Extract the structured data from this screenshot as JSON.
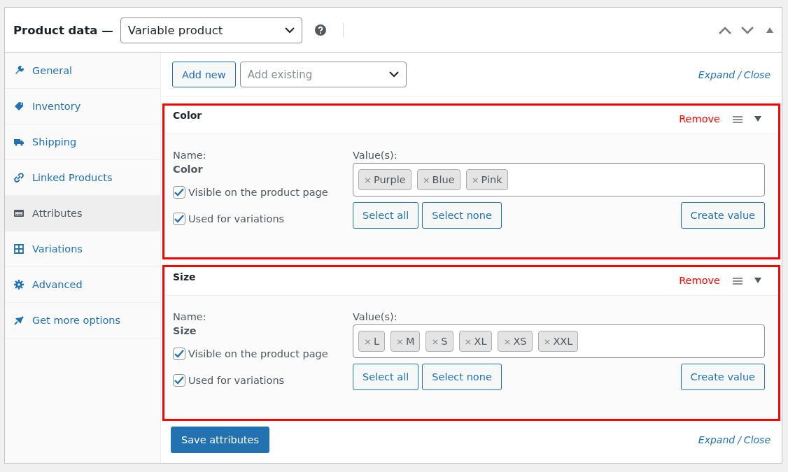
{
  "header": {
    "title": "Product data —",
    "product_type": "Variable product"
  },
  "sidebar": {
    "items": [
      {
        "label": "General",
        "selected": false
      },
      {
        "label": "Inventory",
        "selected": false
      },
      {
        "label": "Shipping",
        "selected": false
      },
      {
        "label": "Linked Products",
        "selected": false
      },
      {
        "label": "Attributes",
        "selected": true
      },
      {
        "label": "Variations",
        "selected": false
      },
      {
        "label": "Advanced",
        "selected": false
      },
      {
        "label": "Get more options",
        "selected": false
      }
    ]
  },
  "toolbar": {
    "add_button": "Add new",
    "existing_select": {
      "placeholder": "Add existing"
    },
    "expand": "Expand",
    "separator": "/",
    "close": "Close"
  },
  "attributes": [
    {
      "title": "Color",
      "highlighted": true,
      "remove": "Remove",
      "name_label": "Name:",
      "name": "Color",
      "visible": {
        "label": "Visible on the product page",
        "checked": true
      },
      "variations": {
        "label": "Used for variations",
        "checked": true
      },
      "values_label": "Value(s):",
      "values": [
        {
          "x": "×",
          "label": "Purple"
        },
        {
          "x": "×",
          "label": "Blue"
        },
        {
          "x": "×",
          "label": "Pink"
        }
      ],
      "select_all": "Select all",
      "select_none": "Select none",
      "create": "Create value"
    },
    {
      "title": "Size",
      "highlighted": true,
      "remove": "Remove",
      "name_label": "Name:",
      "name": "Size",
      "visible": {
        "label": "Visible on the product page",
        "checked": true
      },
      "variations": {
        "label": "Used for variations",
        "checked": true
      },
      "values_label": "Value(s):",
      "values": [
        {
          "x": "×",
          "label": "L"
        },
        {
          "x": "×",
          "label": "M"
        },
        {
          "x": "×",
          "label": "S"
        },
        {
          "x": "×",
          "label": "XL"
        },
        {
          "x": "×",
          "label": "XS"
        },
        {
          "x": "×",
          "label": "XXL"
        }
      ],
      "select_all": "Select all",
      "select_none": "Select none",
      "create": "Create value"
    }
  ],
  "footer": {
    "save_button": "Save attributes",
    "expand": "Expand",
    "separator": "/",
    "close": "Close"
  }
}
